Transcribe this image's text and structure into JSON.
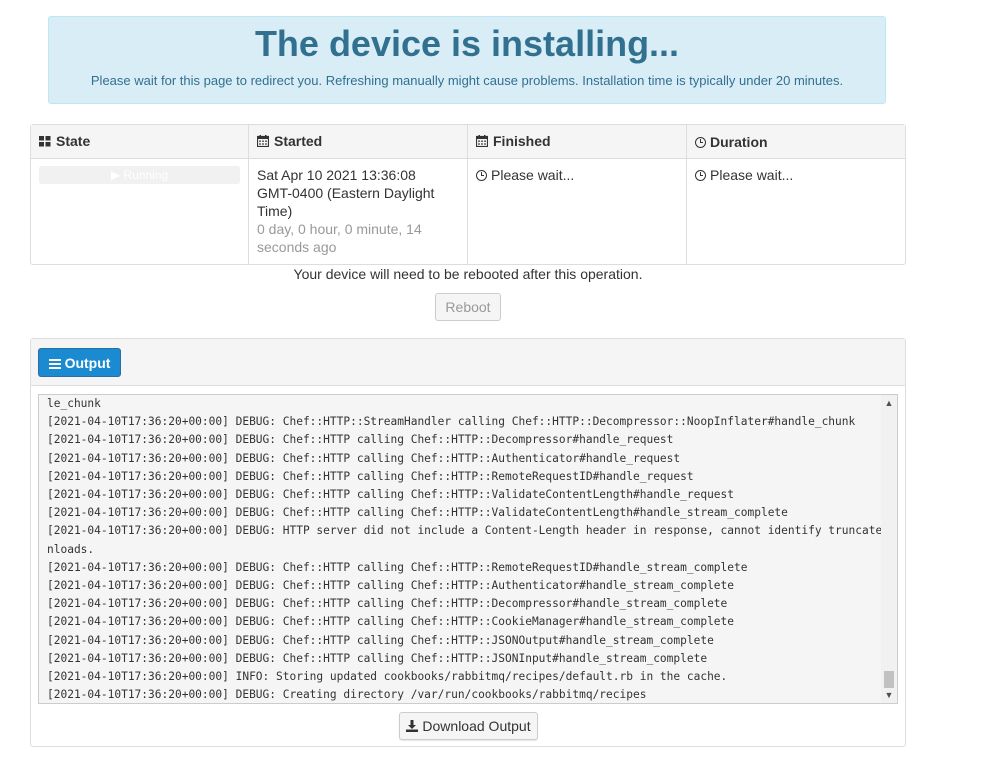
{
  "banner": {
    "title": "The device is installing...",
    "subtitle": "Please wait for this page to redirect you. Refreshing manually might cause problems. Installation time is typically under 20 minutes."
  },
  "status_table": {
    "headers": {
      "state": "State",
      "started": "Started",
      "finished": "Finished",
      "duration": "Duration"
    },
    "row": {
      "state_label": "▶ Running",
      "started_line1": "Sat Apr 10 2021 13:36:08",
      "started_line2": "GMT-0400 (Eastern Daylight Time)",
      "elapsed": "0 day, 0 hour, 0 minute, 14 seconds ago",
      "finished": "Please wait...",
      "duration": "Please wait..."
    },
    "icons": {
      "state": "th-large-icon",
      "started": "calendar-icon",
      "finished": "calendar-icon",
      "duration": "clock-icon"
    }
  },
  "reboot": {
    "note": "Your device will need to be rebooted after this operation.",
    "button_label": "Reboot"
  },
  "output": {
    "tab_label": "Output",
    "download_label": "Download Output",
    "log_lines": [
      "le_chunk",
      "[2021-04-10T17:36:20+00:00] DEBUG: Chef::HTTP::StreamHandler calling Chef::HTTP::Decompressor::NoopInflater#handle_chunk",
      "[2021-04-10T17:36:20+00:00] DEBUG: Chef::HTTP calling Chef::HTTP::Decompressor#handle_request",
      "[2021-04-10T17:36:20+00:00] DEBUG: Chef::HTTP calling Chef::HTTP::Authenticator#handle_request",
      "[2021-04-10T17:36:20+00:00] DEBUG: Chef::HTTP calling Chef::HTTP::RemoteRequestID#handle_request",
      "[2021-04-10T17:36:20+00:00] DEBUG: Chef::HTTP calling Chef::HTTP::ValidateContentLength#handle_request",
      "[2021-04-10T17:36:20+00:00] DEBUG: Chef::HTTP calling Chef::HTTP::ValidateContentLength#handle_stream_complete",
      "[2021-04-10T17:36:20+00:00] DEBUG: HTTP server did not include a Content-Length header in response, cannot identify truncated dow",
      "nloads.",
      "[2021-04-10T17:36:20+00:00] DEBUG: Chef::HTTP calling Chef::HTTP::RemoteRequestID#handle_stream_complete",
      "[2021-04-10T17:36:20+00:00] DEBUG: Chef::HTTP calling Chef::HTTP::Authenticator#handle_stream_complete",
      "[2021-04-10T17:36:20+00:00] DEBUG: Chef::HTTP calling Chef::HTTP::Decompressor#handle_stream_complete",
      "[2021-04-10T17:36:20+00:00] DEBUG: Chef::HTTP calling Chef::HTTP::CookieManager#handle_stream_complete",
      "[2021-04-10T17:36:20+00:00] DEBUG: Chef::HTTP calling Chef::HTTP::JSONOutput#handle_stream_complete",
      "[2021-04-10T17:36:20+00:00] DEBUG: Chef::HTTP calling Chef::HTTP::JSONInput#handle_stream_complete",
      "[2021-04-10T17:36:20+00:00] INFO: Storing updated cookbooks/rabbitmq/recipes/default.rb in the cache.",
      "[2021-04-10T17:36:20+00:00] DEBUG: Creating directory /var/run/cookbooks/rabbitmq/recipes"
    ]
  },
  "colors": {
    "banner_bg": "#d9edf7",
    "banner_text": "#31708f",
    "primary_button": "#1a8bd1",
    "muted_text": "#999999"
  }
}
